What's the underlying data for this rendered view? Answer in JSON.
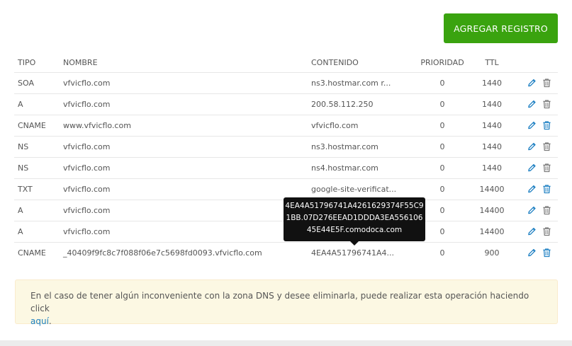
{
  "toolbar": {
    "add_label": "AGREGAR REGISTRO"
  },
  "table": {
    "headers": {
      "tipo": "TIPO",
      "nombre": "NOMBRE",
      "contenido": "CONTENIDO",
      "prioridad": "PRIORIDAD",
      "ttl": "TTL"
    },
    "rows": [
      {
        "tipo": "SOA",
        "nombre": "vfvicflo.com",
        "contenido": "ns3.hostmar.com r...",
        "prioridad": "0",
        "ttl": "1440",
        "delete_active": false
      },
      {
        "tipo": "A",
        "nombre": "vfvicflo.com",
        "contenido": "200.58.112.250",
        "prioridad": "0",
        "ttl": "1440",
        "delete_active": false
      },
      {
        "tipo": "CNAME",
        "nombre": "www.vfvicflo.com",
        "contenido": "vfvicflo.com",
        "prioridad": "0",
        "ttl": "1440",
        "delete_active": true
      },
      {
        "tipo": "NS",
        "nombre": "vfvicflo.com",
        "contenido": "ns3.hostmar.com",
        "prioridad": "0",
        "ttl": "1440",
        "delete_active": false
      },
      {
        "tipo": "NS",
        "nombre": "vfvicflo.com",
        "contenido": "ns4.hostmar.com",
        "prioridad": "0",
        "ttl": "1440",
        "delete_active": false
      },
      {
        "tipo": "TXT",
        "nombre": "vfvicflo.com",
        "contenido": "google-site-verificat...",
        "prioridad": "0",
        "ttl": "14400",
        "delete_active": true
      },
      {
        "tipo": "A",
        "nombre": "vfvicflo.com",
        "contenido": "",
        "prioridad": "0",
        "ttl": "14400",
        "delete_active": false
      },
      {
        "tipo": "A",
        "nombre": "vfvicflo.com",
        "contenido": "",
        "prioridad": "0",
        "ttl": "14400",
        "delete_active": false
      },
      {
        "tipo": "CNAME",
        "nombre": "_40409f9fc8c7f088f06e7c5698fd0093.vfvicflo.com",
        "contenido": "4EA4A51796741A4...",
        "prioridad": "0",
        "ttl": "900",
        "delete_active": true
      }
    ]
  },
  "tooltip": {
    "lines": [
      "4EA4A51796741A4261629374F55C9",
      "1BB.07D276EEAD1DDDA3EA556106",
      "45E44E5F.comodoca.com"
    ]
  },
  "notice": {
    "text": "En el caso de tener algún inconveniente con la zona DNS y desee eliminarla, puede realizar esta operación haciendo click",
    "link": "aquí",
    "trailing": "."
  },
  "colors": {
    "accent_green": "#3aa30f",
    "link_blue": "#1c7fc2",
    "icon_blue": "#1c7fc2",
    "icon_gray": "#777777"
  },
  "icons": {
    "edit": "pencil-icon",
    "delete": "trash-icon"
  }
}
